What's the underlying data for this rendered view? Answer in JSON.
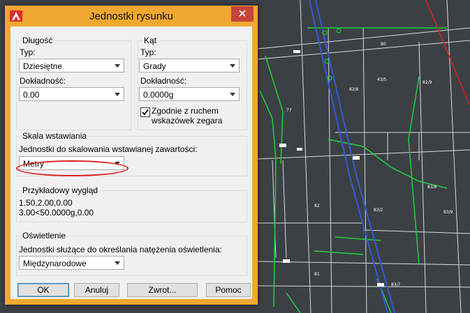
{
  "dialog": {
    "title": "Jednostki rysunku",
    "close_glyph": "✕"
  },
  "length": {
    "legend": "Długość",
    "type_label": "Typ:",
    "type_value": "Dziesiętne",
    "precision_label": "Dokładność:",
    "precision_value": "0.00"
  },
  "angle": {
    "legend": "Kąt",
    "type_label": "Typ:",
    "type_value": "Grady",
    "precision_label": "Dokładność:",
    "precision_value": "0.0000g",
    "clockwise_checked": true,
    "clockwise_line1": "Zgodnie z ruchem",
    "clockwise_line2": "wskazówek zegara"
  },
  "insertion_scale": {
    "legend": "Skala wstawiania",
    "label": "Jednostki do skalowania wstawianej zawartości:",
    "value": "Metry"
  },
  "sample": {
    "legend": "Przykładowy wygląd",
    "line1": "1.50,2.00,0.00",
    "line2": "3.00<50.0000g,0.00"
  },
  "lighting": {
    "legend": "Oświetlenie",
    "label": "Jednostki służące do określania natężenia oświetlenia:",
    "value": "Międzynarodowe"
  },
  "buttons": {
    "ok": "OK",
    "cancel": "Anuluj",
    "direction": "Zwrot...",
    "help": "Pomoc"
  },
  "background_labels": [
    "77",
    "82",
    "81",
    "80",
    "82/8",
    "43/5",
    "82/9",
    "83/6",
    "83/2",
    "83/9",
    "83/7"
  ],
  "icons": [
    "autocad-icon",
    "close-icon",
    "chevron-down-icon",
    "checkmark-icon"
  ],
  "colors": {
    "dialog_frame": "#f0a830",
    "close_button": "#c7433c",
    "cad_background": "#3b4045",
    "parcel_lines": "#1fd13a",
    "road_line": "#2f5bd8",
    "highlight_ellipse": "#e01e1e"
  }
}
